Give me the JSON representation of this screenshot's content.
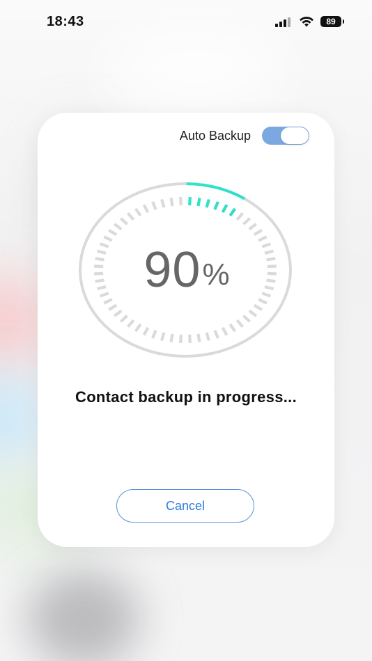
{
  "status_bar": {
    "time": "18:43",
    "battery": "89",
    "icons": [
      "signal-icon",
      "wifi-icon",
      "battery-icon"
    ]
  },
  "card": {
    "auto_backup_label": "Auto Backup",
    "auto_backup_enabled": true,
    "progress_value": "90",
    "progress_unit": "%",
    "progress_fraction": 0.9,
    "status_text": "Contact backup in progress...",
    "cancel_label": "Cancel"
  },
  "colors": {
    "ring_start": "#2a8cf0",
    "ring_end": "#31e5c7",
    "ring_track": "#dadada",
    "accent": "#2f7be0",
    "toggle_on": "#7ba8e0"
  }
}
